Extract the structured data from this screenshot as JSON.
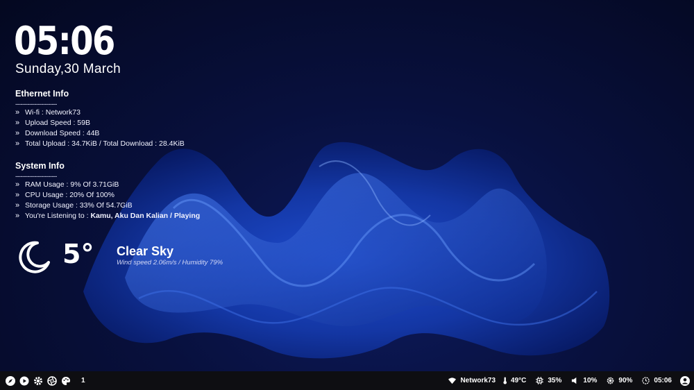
{
  "clock": {
    "time": "05:06",
    "date": "Sunday,30 March"
  },
  "ethernet": {
    "title": "Ethernet Info",
    "divider": "------------------------",
    "lines": [
      "Wi-fi : Network73",
      "Upload Speed : 59B",
      "Download Speed : 44B",
      "Total Upload : 34.7KiB / Total Download : 28.4KiB"
    ]
  },
  "system": {
    "title": "System Info",
    "divider": "------------------------",
    "lines": [
      "RAM Usage : 9% Of 3.71GiB",
      "CPU Usage : 20% Of 100%",
      "Storage Usage : 33% Of 54.7GiB"
    ],
    "listening_prefix": "You're Listening to : ",
    "listening_track": "Kamu, Aku Dan Kalian / Playing"
  },
  "weather": {
    "icon": "moon-icon",
    "temperature": "5°",
    "condition": "Clear Sky",
    "details": "Wind speed 2.06m/s / Humidity 79%"
  },
  "taskbar": {
    "left_icons": [
      "rocket-icon",
      "play-icon",
      "gear-icon",
      "aperture-icon",
      "palette-icon"
    ],
    "workspace": "1",
    "network": "Network73",
    "temperature": "49°C",
    "cpu": "35%",
    "volume": "10%",
    "brightness": "90%",
    "time": "05:06"
  }
}
